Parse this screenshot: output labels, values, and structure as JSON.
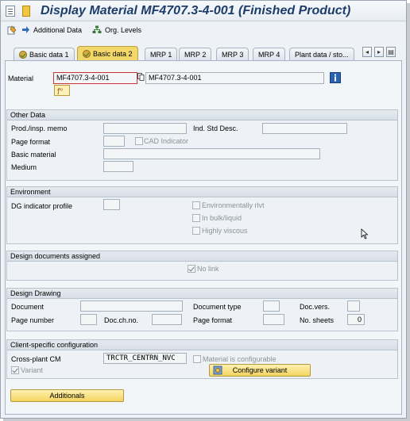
{
  "title": "Display Material MF4707.3-4-001 (Finished Product)",
  "toolbar": {
    "additional_data": "Additional Data",
    "org_levels": "Org. Levels"
  },
  "tabs": [
    {
      "label": "Basic data 1"
    },
    {
      "label": "Basic data 2"
    },
    {
      "label": "MRP 1"
    },
    {
      "label": "MRP 2"
    },
    {
      "label": "MRP 3"
    },
    {
      "label": "MRP 4"
    },
    {
      "label": "Plant data / sto..."
    }
  ],
  "material": {
    "label": "Material",
    "value": "MF4707.3-4-001",
    "description": "MF4707.3-4-001"
  },
  "other_data": {
    "title": "Other Data",
    "prod_memo": "Prod./insp. memo",
    "ind_std_desc": "Ind. Std Desc.",
    "page_format": "Page format",
    "cad_indicator": "CAD Indicator",
    "basic_material": "Basic material",
    "medium": "Medium"
  },
  "environment": {
    "title": "Environment",
    "dg_profile": "DG indicator profile",
    "env_relevant": "Environmentally rlvt",
    "in_bulk": "In bulk/liquid",
    "highly_viscous": "Highly viscous"
  },
  "design_docs": {
    "title": "Design documents assigned",
    "no_link": "No link"
  },
  "design_drawing": {
    "title": "Design Drawing",
    "document": "Document",
    "document_type": "Document type",
    "doc_vers": "Doc.vers.",
    "page_number": "Page number",
    "doc_ch_no": "Doc.ch.no.",
    "page_format": "Page format",
    "no_sheets": "No. sheets",
    "no_sheets_value": "0"
  },
  "client_config": {
    "title": "Client-specific configuration",
    "cross_plant_cm": "Cross-plant CM",
    "cross_plant_cm_value": "TRCTR_CENTRN_NVC",
    "material_configurable": "Material is configurable",
    "variant": "Variant",
    "configure_variant": "Configure variant"
  },
  "additionals": "Additionals"
}
